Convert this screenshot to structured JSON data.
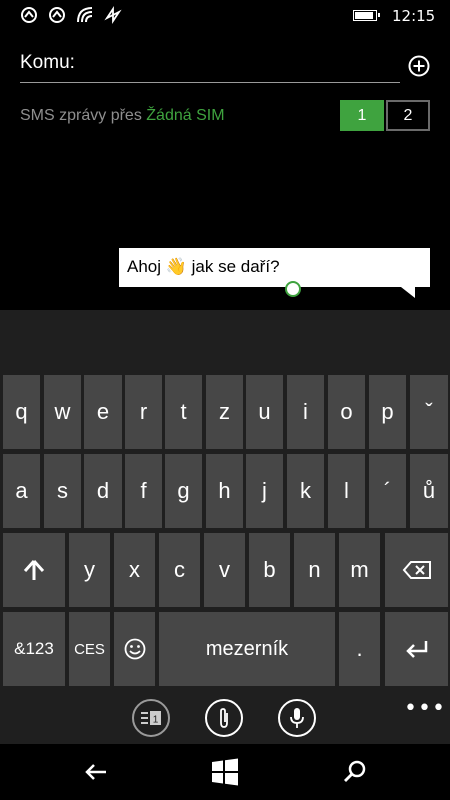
{
  "status_bar": {
    "icons": [
      "notification-icon",
      "notification-icon",
      "wifi-icon",
      "data-sync-icon"
    ],
    "battery_level": 0.95,
    "time": "12:15"
  },
  "message": {
    "to_label": "Komu:",
    "add_recipient_icon": "plus-circle-icon",
    "sms_prefix": "SMS zprávy přes ",
    "sms_sim_name": "Žádná SIM",
    "sim_options": [
      "1",
      "2"
    ],
    "selected_sim": "1",
    "compose_before_emoji": "Ahoj ",
    "compose_emoji": "👋",
    "compose_after_emoji": " jak se daří?"
  },
  "keyboard": {
    "row1": [
      "q",
      "w",
      "e",
      "r",
      "t",
      "z",
      "u",
      "i",
      "o",
      "p",
      "ˇ"
    ],
    "row2": [
      "a",
      "s",
      "d",
      "f",
      "g",
      "h",
      "j",
      "k",
      "l",
      "´",
      "ů"
    ],
    "row3": [
      "y",
      "x",
      "c",
      "v",
      "b",
      "n",
      "m"
    ],
    "shift_icon": "shift-arrow-icon",
    "backspace_icon": "backspace-icon",
    "symbols_label": "&123",
    "language_label": "CES",
    "emoji_icon": "smiley-icon",
    "space_label": "mezerník",
    "period_label": ".",
    "enter_icon": "enter-icon",
    "tools": [
      "sim-switch-icon",
      "attach-icon",
      "microphone-icon"
    ],
    "more_label": "•••"
  },
  "nav": {
    "back_icon": "back-arrow-icon",
    "start_icon": "windows-logo-icon",
    "search_icon": "search-icon"
  },
  "colors": {
    "accent": "#3fa33f",
    "key_background": "#474747",
    "keyboard_background": "#1f1f1f"
  }
}
